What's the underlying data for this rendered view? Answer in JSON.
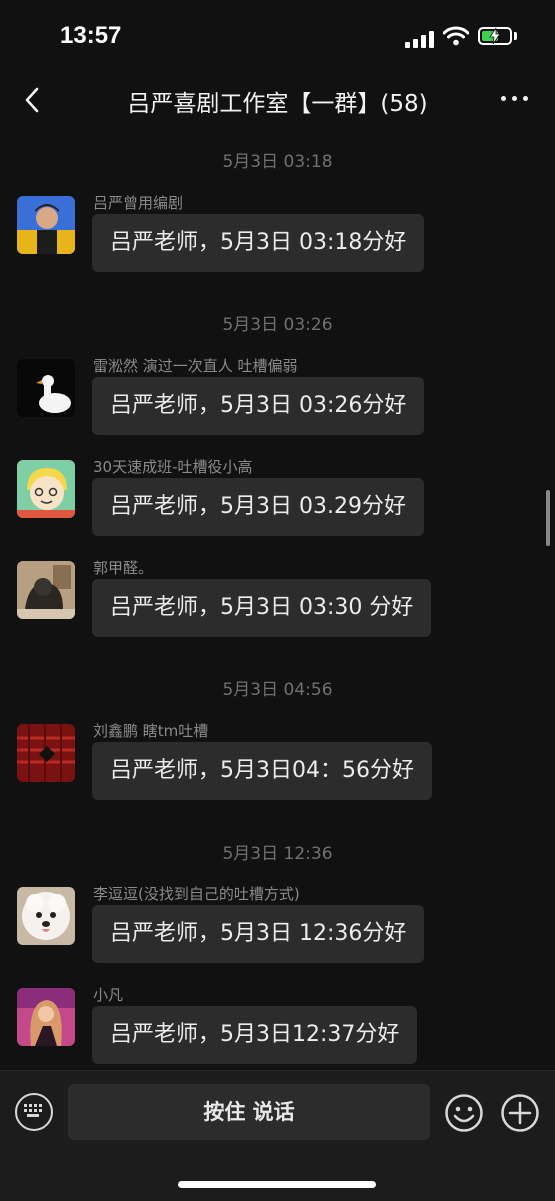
{
  "status_bar": {
    "time": "13:57"
  },
  "header": {
    "title": "吕严喜剧工作室【一群】(58)"
  },
  "messages": [
    {
      "timestamp": "5月3日 03:18",
      "sender": "吕严曾用编剧",
      "text": "吕严老师，5月3日 03:18分好"
    },
    {
      "timestamp": "5月3日 03:26",
      "sender": "雷淞然 演过一次直人 吐槽偏弱",
      "text": "吕严老师，5月3日 03:26分好"
    },
    {
      "sender": "30天速成班-吐槽役小高",
      "text": "吕严老师，5月3日 03.29分好"
    },
    {
      "sender": "郭甲醛。",
      "text": "吕严老师，5月3日 03:30 分好"
    },
    {
      "timestamp": "5月3日 04:56",
      "sender": "刘鑫鹏  瞎tm吐槽",
      "text": "吕严老师，5月3日04：56分好"
    },
    {
      "timestamp": "5月3日 12:36",
      "sender": "李逗逗(没找到自己的吐槽方式)",
      "text": "吕严老师，5月3日 12:36分好"
    },
    {
      "sender": "小凡",
      "text": "吕严老师，5月3日12:37分好"
    }
  ],
  "input_bar": {
    "voice_label": "按住 说话"
  },
  "icons": {
    "back": "chevron-left-icon",
    "more": "more-dots-icon",
    "keyboard": "keyboard-icon",
    "emoji": "emoji-icon",
    "plus": "plus-icon"
  },
  "colors": {
    "background": "#111111",
    "bubble": "#2c2c2c",
    "battery": "#3ecf4e"
  }
}
